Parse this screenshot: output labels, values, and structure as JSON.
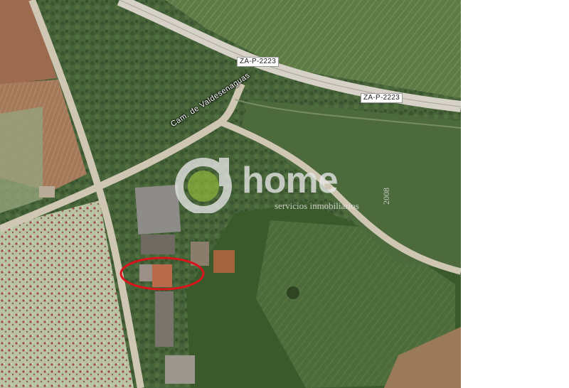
{
  "map": {
    "road_labels": [
      "ZA-P-2223",
      "ZA-P-2223"
    ],
    "street_name": "Cam. de Valdesenaguas",
    "watermark": {
      "brand": "home",
      "year": "2008",
      "tagline": "servicios inmobiliarios"
    },
    "marker": {
      "shape": "ellipse",
      "color": "#d9141b"
    },
    "colors": {
      "road": "#d9d2c4",
      "field_green": "#4f6e3f",
      "field_brown": "#a77a5c",
      "scrub": "#3d5a33"
    }
  }
}
